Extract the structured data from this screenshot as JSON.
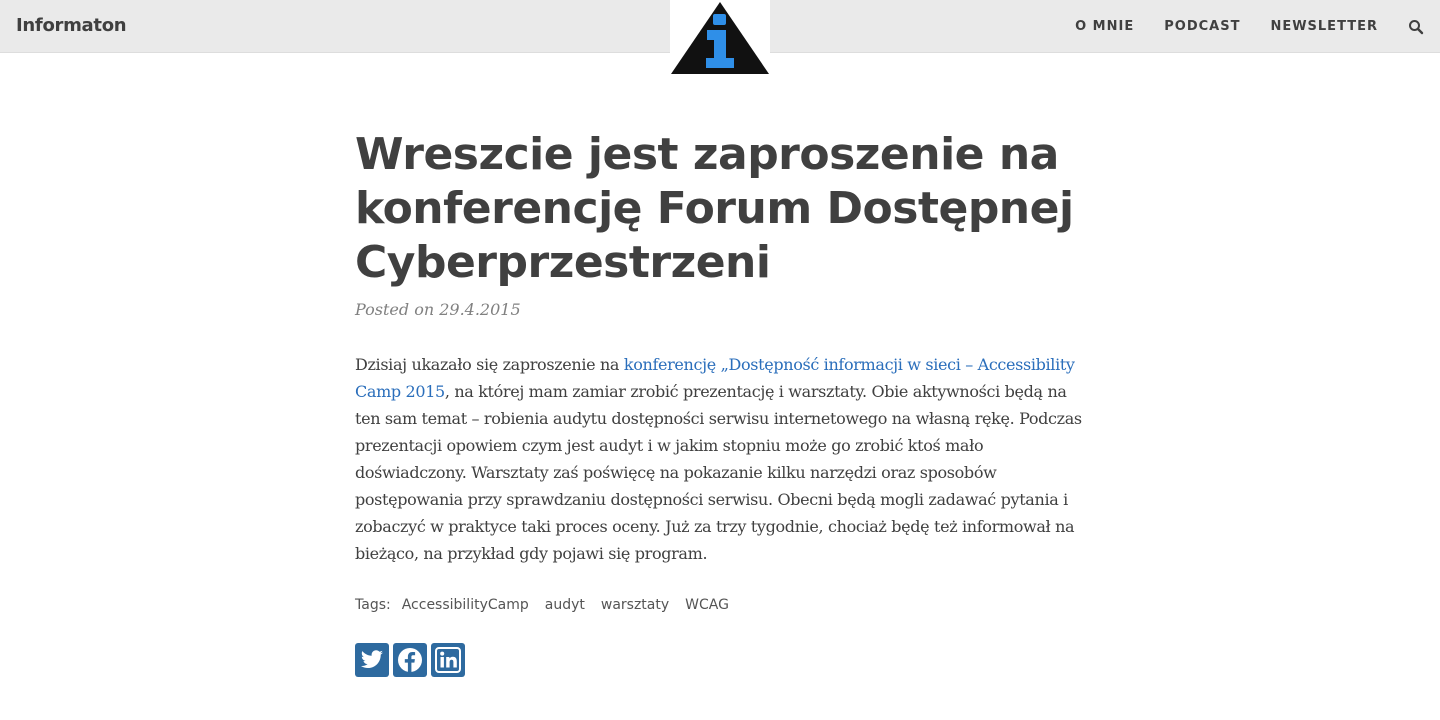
{
  "navbar": {
    "brand": "Informaton",
    "links": [
      "O MNIE",
      "PODCAST",
      "NEWSLETTER"
    ],
    "search_icon": "search-icon"
  },
  "logo": {
    "icon": "info-triangle-logo",
    "colors": {
      "triangle": "#111111",
      "letter": "#2f8fe8"
    }
  },
  "post": {
    "title": "Wreszcie jest zaproszenie na konferencję Forum Dostępnej Cyberprzestrzeni",
    "meta": "Posted on 29.4.2015",
    "body_before_link": "Dzisiaj ukazało się zaproszenie na ",
    "body_link": "konferencję „Dostępność informacji w sieci – Accessibility Camp 2015",
    "body_after_link": ", na której mam zamiar zrobić prezentację i warsztaty. Obie aktywności będą na ten sam temat – robienia audytu dostępności serwisu internetowego na własną rękę. Podczas prezentacji opowiem czym jest audyt i w jakim stopniu może go zrobić ktoś mało doświadczony. Warsztaty zaś poświęcę na pokazanie kilku narzędzi oraz sposobów postępowania przy sprawdzaniu dostępności serwisu. Obecni będą mogli zadawać pytania i zobaczyć w praktyce taki proces oceny. Już za trzy tygodnie, chociaż będę też informował na bieżąco, na przykład gdy pojawi się program."
  },
  "tags": {
    "label": "Tags:",
    "items": [
      "AccessibilityCamp",
      "audyt",
      "warsztaty",
      "WCAG"
    ]
  },
  "share": {
    "buttons": [
      "twitter-icon",
      "facebook-icon",
      "linkedin-icon"
    ],
    "color": "#2e6a9f"
  },
  "colors": {
    "accent_link": "#2a6ebb",
    "navbar_bg": "#eaeaea",
    "text": "#404040"
  }
}
